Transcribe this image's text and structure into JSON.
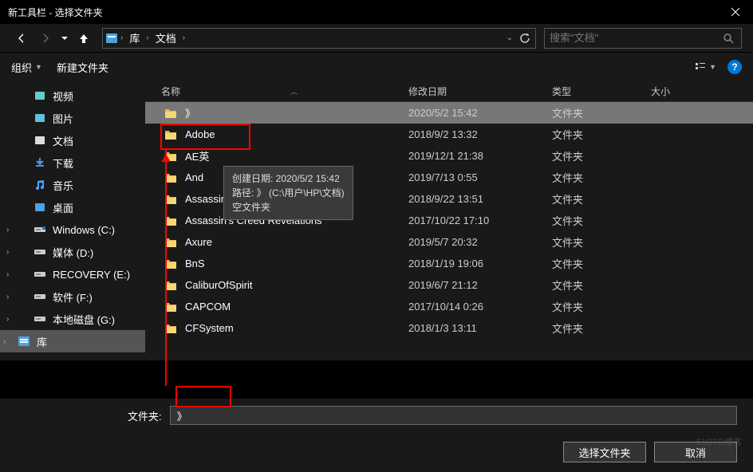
{
  "title": "新工具栏 - 选择文件夹",
  "breadcrumb": {
    "seg1": "库",
    "seg2": "文档"
  },
  "search": {
    "placeholder": "搜索\"文档\""
  },
  "toolbar": {
    "organize": "组织",
    "newfolder": "新建文件夹"
  },
  "sidebar": [
    {
      "label": "视频",
      "icon": "video"
    },
    {
      "label": "图片",
      "icon": "picture"
    },
    {
      "label": "文档",
      "icon": "document"
    },
    {
      "label": "下载",
      "icon": "download"
    },
    {
      "label": "音乐",
      "icon": "music"
    },
    {
      "label": "桌面",
      "icon": "desktop"
    },
    {
      "label": "Windows (C:)",
      "icon": "drive-os"
    },
    {
      "label": "媒体 (D:)",
      "icon": "drive"
    },
    {
      "label": "RECOVERY (E:)",
      "icon": "drive"
    },
    {
      "label": "软件 (F:)",
      "icon": "drive"
    },
    {
      "label": "本地磁盘 (G:)",
      "icon": "drive"
    },
    {
      "label": "库",
      "icon": "library",
      "selected": true
    }
  ],
  "columns": {
    "name": "名称",
    "date": "修改日期",
    "type": "类型",
    "size": "大小"
  },
  "files": [
    {
      "name": "》",
      "date": "2020/5/2 15:42",
      "type": "文件夹",
      "selected": true
    },
    {
      "name": "Adobe",
      "date": "2018/9/2 13:32",
      "type": "文件夹"
    },
    {
      "name": "AE英",
      "date": "2019/12/1 21:38",
      "type": "文件夹"
    },
    {
      "name": "And",
      "date": "2019/7/13 0:55",
      "type": "文件夹"
    },
    {
      "name": "Assassin's Creed III",
      "date": "2018/9/22 13:51",
      "type": "文件夹"
    },
    {
      "name": "Assassin's Creed Revelations",
      "date": "2017/10/22 17:10",
      "type": "文件夹"
    },
    {
      "name": "Axure",
      "date": "2019/5/7 20:32",
      "type": "文件夹"
    },
    {
      "name": "BnS",
      "date": "2018/1/19 19:06",
      "type": "文件夹"
    },
    {
      "name": "CaliburOfSpirit",
      "date": "2019/6/7 21:12",
      "type": "文件夹"
    },
    {
      "name": "CAPCOM",
      "date": "2017/10/14 0:26",
      "type": "文件夹"
    },
    {
      "name": "CFSystem",
      "date": "2018/1/3 13:11",
      "type": "文件夹"
    }
  ],
  "tooltip": {
    "line1": "创建日期: 2020/5/2 15:42",
    "line2": "路径: 》 (C:\\用户\\HP\\文档)",
    "line3": "空文件夹"
  },
  "folderfield": {
    "label": "文件夹:",
    "value": "》"
  },
  "buttons": {
    "select": "选择文件夹",
    "cancel": "取消"
  },
  "watermark": "51CTO博客"
}
